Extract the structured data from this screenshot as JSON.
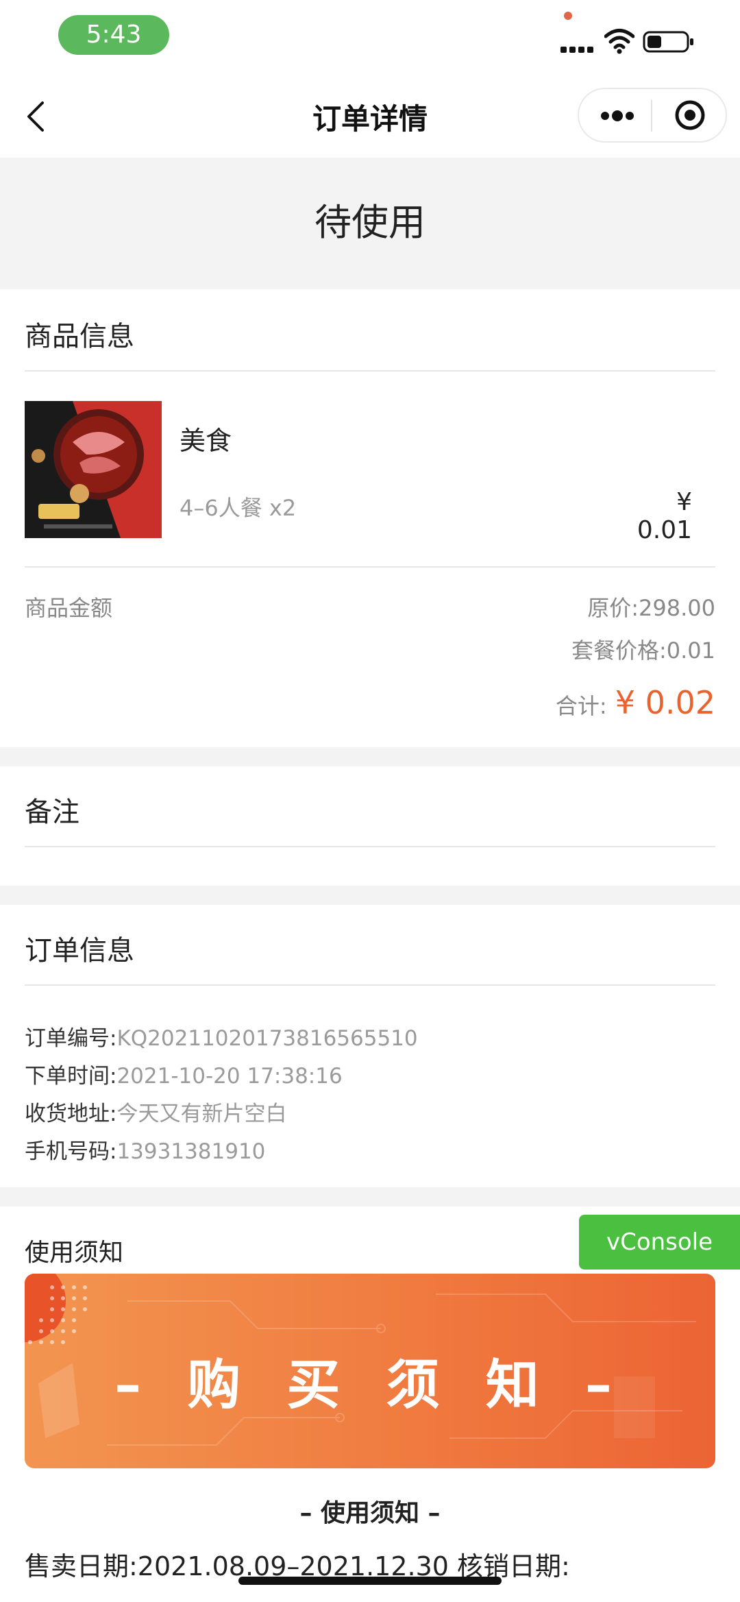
{
  "status_bar": {
    "time": "5:43"
  },
  "nav": {
    "title": "订单详情"
  },
  "order_status": "待使用",
  "product_section": {
    "title": "商品信息",
    "product": {
      "name": "美食",
      "spec": "4–6人餐 x2",
      "price": "¥ 0.01"
    }
  },
  "amount": {
    "label": "商品金额",
    "original_label": "原价:",
    "original_value": "298.00",
    "package_label": "套餐价格:",
    "package_value": "0.01",
    "total_label": "合计:",
    "total_value": "¥ 0.02"
  },
  "remark": {
    "title": "备注"
  },
  "order_info": {
    "title": "订单信息",
    "rows": [
      {
        "label": "订单编号:",
        "value": "KQ20211020173816565510"
      },
      {
        "label": "下单时间:",
        "value": "2021-10-20 17:38:16"
      },
      {
        "label": "收货地址:",
        "value": "今天又有新片空白"
      },
      {
        "label": "手机号码:",
        "value": "13931381910"
      }
    ]
  },
  "usage": {
    "title": "使用须知",
    "banner_text": "– 购 买 须 知 –",
    "subheading": "– 使用须知 –",
    "sale_line": "售卖日期:2021.08.09–2021.12.30 核销日期:"
  },
  "vconsole": {
    "label": "vConsole"
  },
  "colors": {
    "accent": "#e8632e",
    "vconsole": "#4bbf3f",
    "time_pill": "#5cb85c"
  }
}
